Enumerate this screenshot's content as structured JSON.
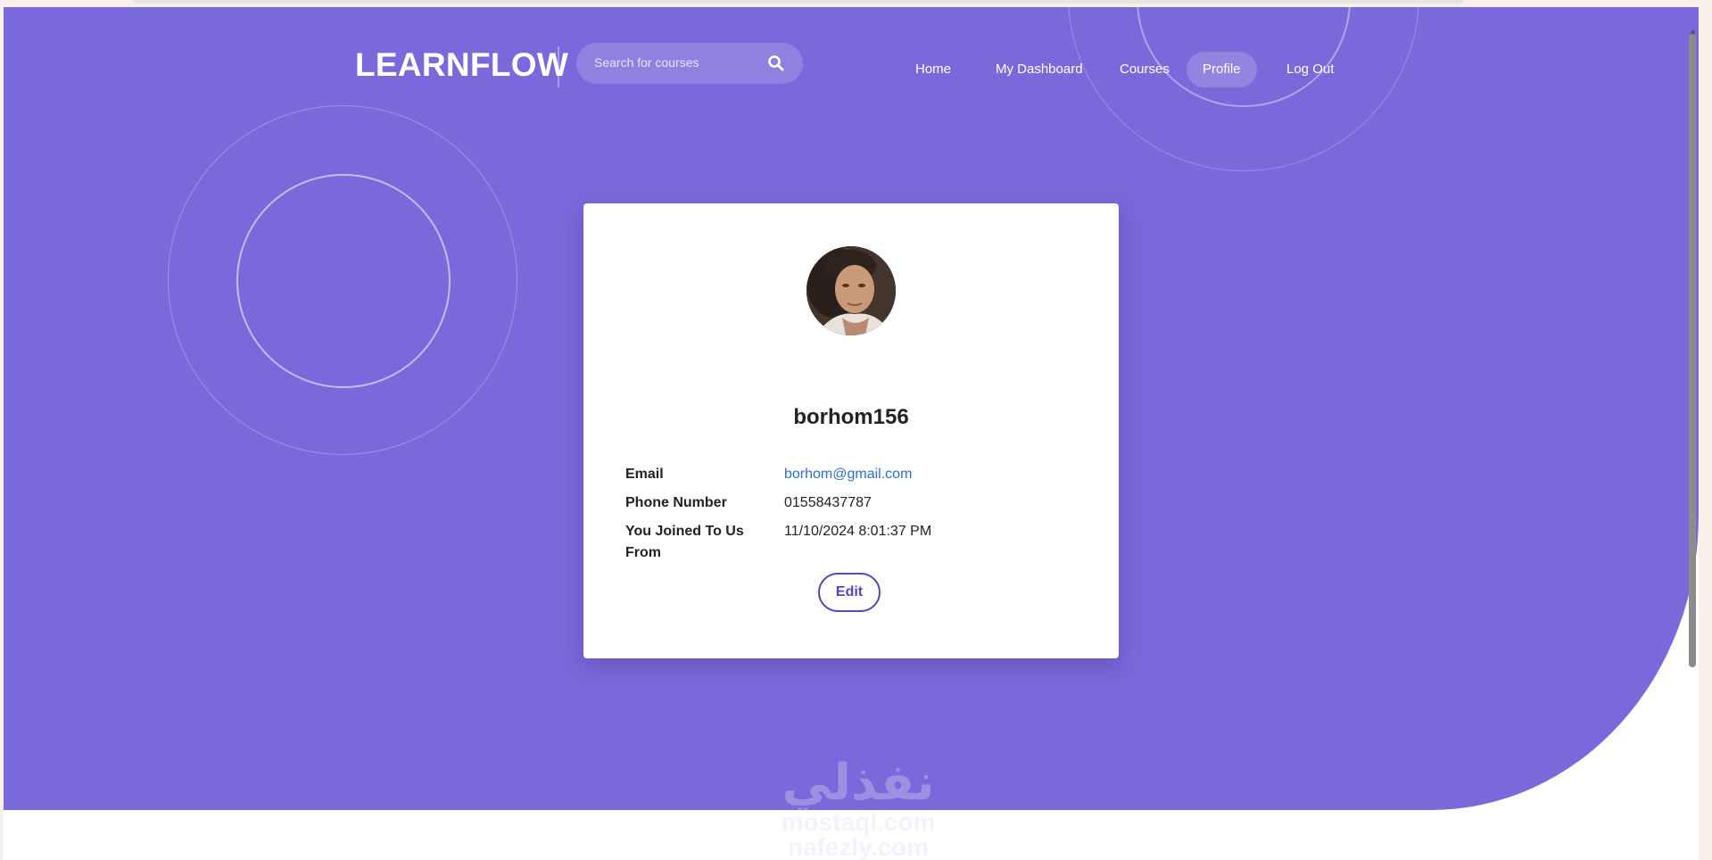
{
  "header": {
    "brand": "LEARNFLOW",
    "search_placeholder": "Search for  courses",
    "nav": [
      {
        "label": "Home"
      },
      {
        "label": "My Dashboard"
      },
      {
        "label": "Courses"
      },
      {
        "label": "Profile",
        "active": true
      },
      {
        "label": "Log Out"
      }
    ]
  },
  "profile": {
    "username": "borhom156",
    "fields": [
      {
        "label": "Email",
        "value": "borhom@gmail.com"
      },
      {
        "label": "Phone Number",
        "value": "01558437787"
      },
      {
        "label": "You Joined To Us From",
        "value": "11/10/2024 8:01:37 PM"
      }
    ],
    "edit_label": "Edit"
  },
  "watermark": {
    "arabic": "نفذلي",
    "line1": "mostaql.com",
    "line2": "nafezly.com"
  },
  "colors": {
    "hero_bg": "#7a69da",
    "accent": "#5b45b8",
    "link": "#2a6fd0"
  }
}
